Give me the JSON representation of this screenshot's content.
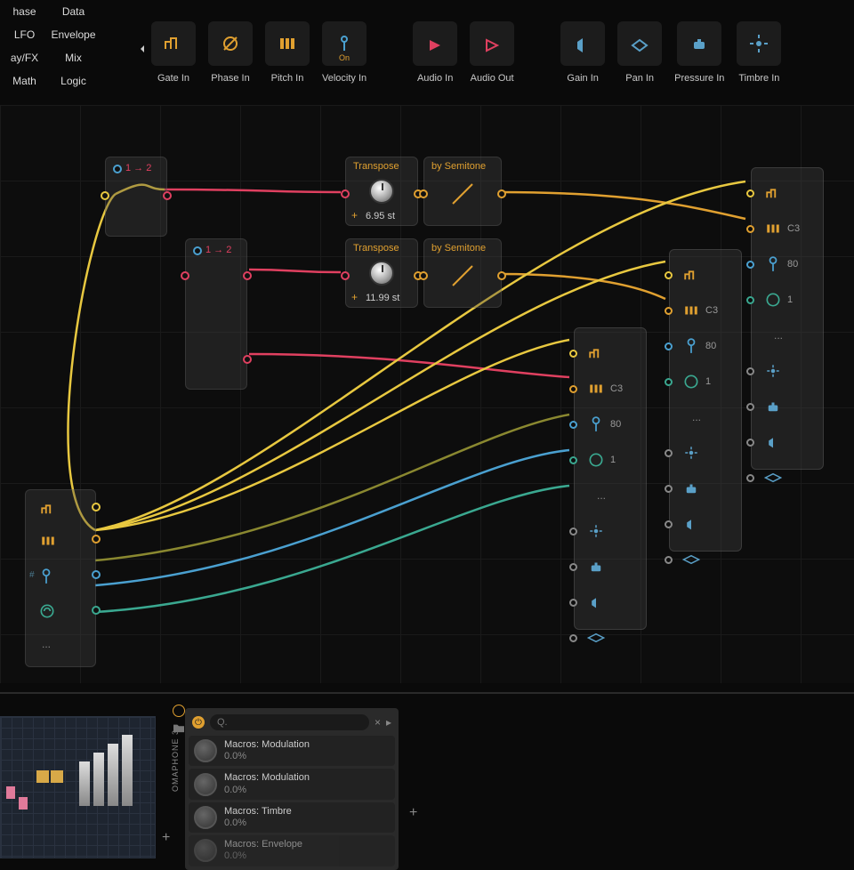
{
  "categories": {
    "col1": [
      "hase",
      "LFO",
      "ay/FX",
      "Math"
    ],
    "col2": [
      "Data",
      "Envelope",
      "Mix",
      "Logic"
    ]
  },
  "palette": [
    {
      "id": "gate-in",
      "label": "Gate In",
      "color": "#e0a030",
      "sub": ""
    },
    {
      "id": "phase-in",
      "label": "Phase In",
      "color": "#e0a030",
      "sub": ""
    },
    {
      "id": "pitch-in",
      "label": "Pitch In",
      "color": "#e0a030",
      "sub": ""
    },
    {
      "id": "velocity-in",
      "label": "Velocity In",
      "color": "#4aa0d0",
      "sub": "On"
    },
    {
      "id": "gap1"
    },
    {
      "id": "audio-in",
      "label": "Audio In",
      "color": "#e04060",
      "sub": ""
    },
    {
      "id": "audio-out",
      "label": "Audio Out",
      "color": "#e04060",
      "sub": ""
    },
    {
      "id": "gap2"
    },
    {
      "id": "gain-in",
      "label": "Gain In",
      "color": "#5aa0c8",
      "sub": ""
    },
    {
      "id": "pan-in",
      "label": "Pan In",
      "color": "#5aa0c8",
      "sub": ""
    },
    {
      "id": "pressure-in",
      "label": "Pressure In",
      "color": "#5aa0c8",
      "sub": ""
    },
    {
      "id": "timbre-in",
      "label": "Timbre In",
      "color": "#5aa0c8",
      "sub": ""
    }
  ],
  "nodes": {
    "split1": {
      "label": "1 → 2"
    },
    "split2": {
      "label": "1 → 2"
    },
    "transpose1": {
      "title": "Transpose",
      "mode": "by Semitone",
      "value": "6.95 st",
      "plus": "+"
    },
    "transpose2": {
      "title": "Transpose",
      "mode": "by Semitone",
      "value": "11.99 st",
      "plus": "+"
    }
  },
  "sinks": {
    "labels": {
      "pitch": "C3",
      "velocity": "80",
      "pressure": "1",
      "dots": "..."
    }
  },
  "device": {
    "name": "OMAPHONE 3",
    "search_placeholder": "Q.",
    "macros": [
      {
        "name": "Macros: Modulation",
        "value": "0.0%"
      },
      {
        "name": "Macros: Modulation",
        "value": "0.0%"
      },
      {
        "name": "Macros: Timbre",
        "value": "0.0%"
      },
      {
        "name": "Macros: Envelope",
        "value": "0.0%"
      }
    ]
  },
  "colors": {
    "orange": "#e0a030",
    "yellow": "#e8c840",
    "red": "#e04060",
    "cyan": "#4aa0d0",
    "teal": "#3aa890",
    "blue": "#5a8cc0"
  }
}
